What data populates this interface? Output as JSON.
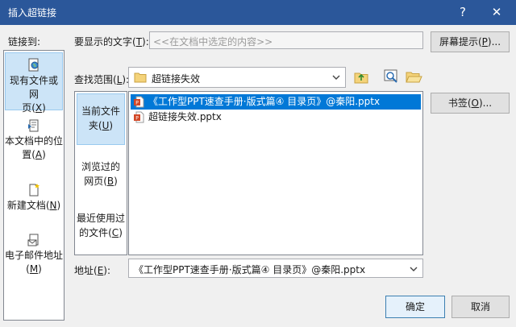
{
  "window": {
    "title": "插入超链接",
    "help": "?",
    "close": "✕"
  },
  "link_to": {
    "label": "链接到:"
  },
  "sidebar": {
    "items": [
      {
        "line1": "现有文件或网",
        "line2": "页(",
        "key": "X",
        "tail": ")"
      },
      {
        "line1": "本文档中的位",
        "line2": "置(",
        "key": "A",
        "tail": ")"
      },
      {
        "line1": "新建文档(",
        "line2": "",
        "key": "N",
        "tail": ")"
      },
      {
        "line1": "电子邮件地址",
        "line2": "(",
        "key": "M",
        "tail": ")"
      }
    ]
  },
  "display_text": {
    "label": "要显示的文字(",
    "key": "T",
    "tail": "):",
    "value": "<<在文档中选定的内容>>"
  },
  "screen_tip": {
    "label": "屏幕提示(",
    "key": "P",
    "tail": ")..."
  },
  "look_in": {
    "label": "查找范围(",
    "key": "L",
    "tail": "):",
    "value": "超链接失效"
  },
  "places": {
    "items": [
      {
        "line1": "当前文件",
        "line2": "夹(",
        "key": "U",
        "tail": ")"
      },
      {
        "line1": "浏览过的",
        "line2": "网页(",
        "key": "B",
        "tail": ")"
      },
      {
        "line1": "最近使用过",
        "line2": "的文件(",
        "key": "C",
        "tail": ")"
      }
    ]
  },
  "files": [
    {
      "name": "《工作型PPT速查手册·版式篇④ 目录页》@秦阳.pptx",
      "selected": true
    },
    {
      "name": "超链接失效.pptx",
      "selected": false
    }
  ],
  "bookmark": {
    "label": "书签(",
    "key": "O",
    "tail": ")..."
  },
  "address": {
    "label": "地址(",
    "key": "E",
    "tail": "):",
    "value": "《工作型PPT速查手册·版式篇④ 目录页》@秦阳.pptx"
  },
  "ok_label": "确定",
  "cancel_label": "取消",
  "colors": {
    "titlebar": "#2b579a",
    "selection": "#0078d7",
    "sidebar_active": "#cce4f7"
  }
}
